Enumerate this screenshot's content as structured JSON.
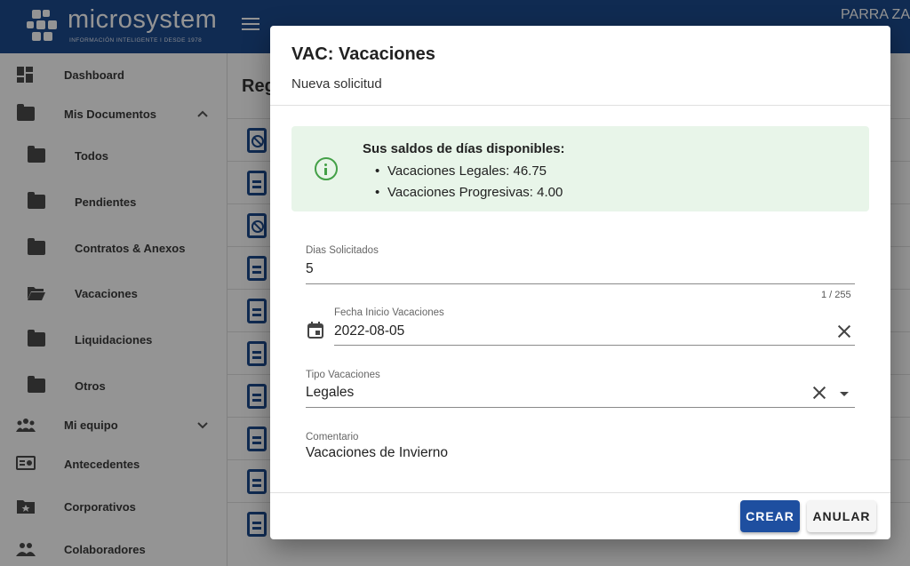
{
  "header": {
    "brand_name": "microsystem",
    "brand_tagline": "INFORMACIÓN INTELIGENTE I DESDE 1978",
    "user_name": "PARRA ZA"
  },
  "sidebar": {
    "items": [
      {
        "label": "Dashboard",
        "icon": "dashboard-icon"
      },
      {
        "label": "Mis Documentos",
        "icon": "folder-icon",
        "expanded": true
      },
      {
        "label": "Todos",
        "icon": "folder-icon"
      },
      {
        "label": "Pendientes",
        "icon": "folder-icon"
      },
      {
        "label": "Contratos & Anexos",
        "icon": "folder-icon"
      },
      {
        "label": "Vacaciones",
        "icon": "folder-open-icon",
        "selected": true
      },
      {
        "label": "Liquidaciones",
        "icon": "folder-icon"
      },
      {
        "label": "Otros",
        "icon": "folder-icon"
      },
      {
        "label": "Mi equipo",
        "icon": "team-icon",
        "expanded": false
      },
      {
        "label": "Antecedentes",
        "icon": "id-card-icon"
      },
      {
        "label": "Corporativos",
        "icon": "folder-star-icon"
      },
      {
        "label": "Colaboradores",
        "icon": "people-icon"
      }
    ]
  },
  "main": {
    "title_partial": "Reg"
  },
  "dialog": {
    "title": "VAC: Vacaciones",
    "subtitle": "Nueva solicitud",
    "alert": {
      "title": "Sus saldos de días disponibles:",
      "items": [
        "Vacaciones Legales: 46.75",
        "Vacaciones Progresivas: 4.00"
      ],
      "color": "#e8f5e9",
      "icon": "info-icon"
    },
    "fields": {
      "dias": {
        "label": "Dias Solicitados",
        "value": "5",
        "counter": "1 / 255"
      },
      "fecha": {
        "label": "Fecha Inicio Vacaciones",
        "value": "2022-08-05"
      },
      "tipo": {
        "label": "Tipo Vacaciones",
        "value": "Legales"
      },
      "comentario": {
        "label": "Comentario",
        "value": "Vacaciones de Invierno"
      }
    },
    "buttons": {
      "create": "CREAR",
      "cancel": "ANULAR"
    },
    "colors": {
      "primary": "#1e4fa0",
      "header": "#1d4a8e"
    }
  }
}
